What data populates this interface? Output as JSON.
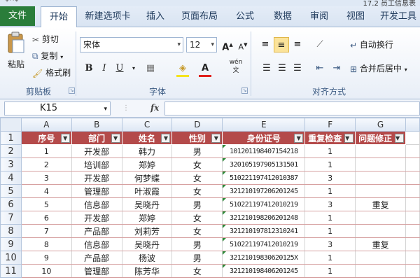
{
  "window": {
    "document_title": "17.2 员工信息表"
  },
  "tabs": [
    {
      "label": "文件"
    },
    {
      "label": "开始"
    },
    {
      "label": "新建选项卡"
    },
    {
      "label": "插入"
    },
    {
      "label": "页面布局"
    },
    {
      "label": "公式"
    },
    {
      "label": "数据"
    },
    {
      "label": "审阅"
    },
    {
      "label": "视图"
    },
    {
      "label": "开发工具"
    }
  ],
  "ribbon": {
    "clipboard": {
      "paste": "粘贴",
      "cut": "剪切",
      "copy": "复制",
      "format_painter": "格式刷",
      "group": "剪贴板"
    },
    "font": {
      "name": "宋体",
      "size": "12",
      "bold": "B",
      "italic": "I",
      "underline": "U",
      "group": "字体",
      "wen": "wén"
    },
    "alignment": {
      "wrap": "自动换行",
      "merge": "合并后居中",
      "group": "对齐方式"
    }
  },
  "formula_bar": {
    "name_box": "K15",
    "fx": "fx",
    "value": ""
  },
  "columns": [
    "A",
    "B",
    "C",
    "D",
    "E",
    "F",
    "G"
  ],
  "rows": [
    "1",
    "2",
    "3",
    "4",
    "5",
    "6",
    "7",
    "8",
    "9",
    "10",
    "11"
  ],
  "headers": [
    "序号",
    "部门",
    "姓名",
    "性别",
    "身份证号",
    "重复检查",
    "问题修正"
  ],
  "records": [
    [
      "1",
      "开发部",
      "韩力",
      "男",
      "101201198407154218",
      "1",
      ""
    ],
    [
      "2",
      "培训部",
      "郑婷",
      "女",
      "320105197905131501",
      "1",
      ""
    ],
    [
      "3",
      "开发部",
      "何梦蝶",
      "女",
      "510221197412010387",
      "3",
      ""
    ],
    [
      "4",
      "管理部",
      "叶淑霞",
      "女",
      "321210197206201245",
      "1",
      ""
    ],
    [
      "5",
      "信息部",
      "吴晓丹",
      "男",
      "510221197412010219",
      "3",
      "重复"
    ],
    [
      "6",
      "开发部",
      "郑婷",
      "女",
      "321210198206201248",
      "1",
      ""
    ],
    [
      "7",
      "产品部",
      "刘莉芳",
      "女",
      "321210197812310241",
      "1",
      ""
    ],
    [
      "8",
      "信息部",
      "吴晓丹",
      "男",
      "510221197412010219",
      "3",
      "重复"
    ],
    [
      "9",
      "产品部",
      "杨波",
      "男",
      "32121019830620125X",
      "1",
      ""
    ],
    [
      "10",
      "管理部",
      "陈芳华",
      "女",
      "321210198406201245",
      "1",
      ""
    ]
  ]
}
